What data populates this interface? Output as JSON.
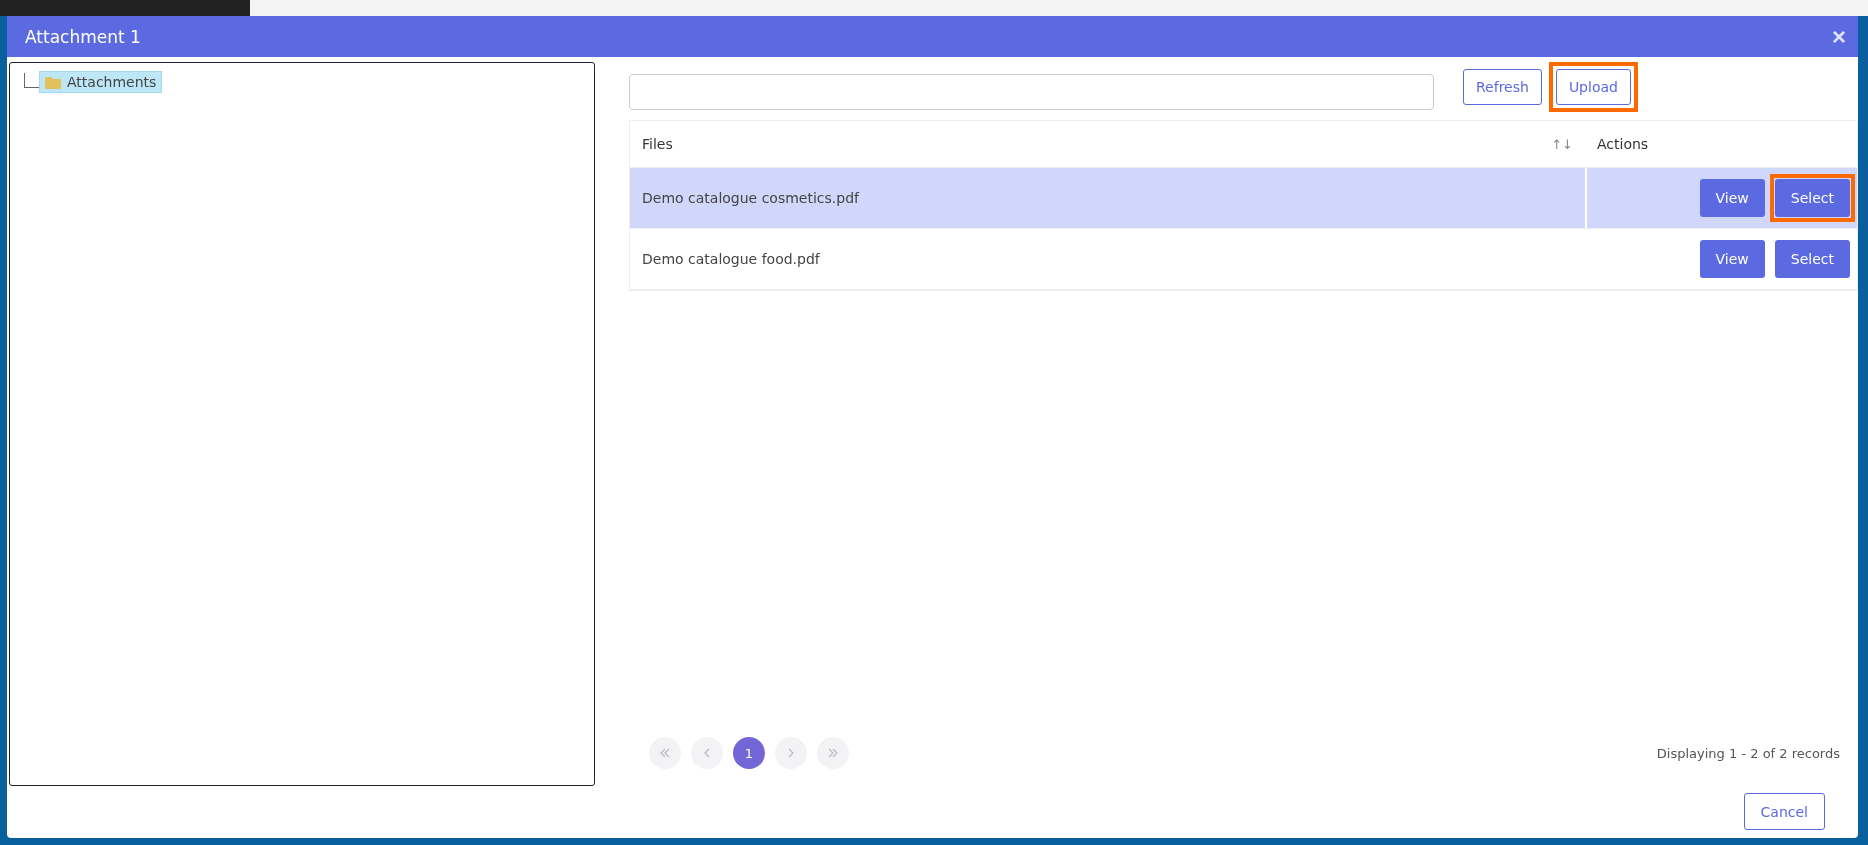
{
  "dialog": {
    "title": "Attachment 1",
    "close": "×"
  },
  "tree": [
    {
      "label": "Attachments",
      "selected": true
    }
  ],
  "toolbar": [
    {
      "label": "Refresh",
      "highlighted": false
    },
    {
      "label": "Upload",
      "highlighted": true
    }
  ],
  "table": {
    "columns": [
      "Files",
      "Actions"
    ],
    "sort_icon": "↑↓",
    "rows": [
      {
        "file": "Demo catalogue cosmetics.pdf",
        "selected": true,
        "actions": [
          {
            "label": "View",
            "highlighted": false
          },
          {
            "label": "Select",
            "highlighted": true
          }
        ]
      },
      {
        "file": "Demo catalogue food.pdf",
        "selected": false,
        "actions": [
          {
            "label": "View",
            "highlighted": false
          },
          {
            "label": "Select",
            "highlighted": false
          }
        ]
      }
    ]
  },
  "pagination": {
    "pages": [
      {
        "label": "1",
        "selected": true
      }
    ],
    "status": "Displaying 1 - 2 of 2 records"
  },
  "footer_buttons": [
    "Cancel"
  ]
}
